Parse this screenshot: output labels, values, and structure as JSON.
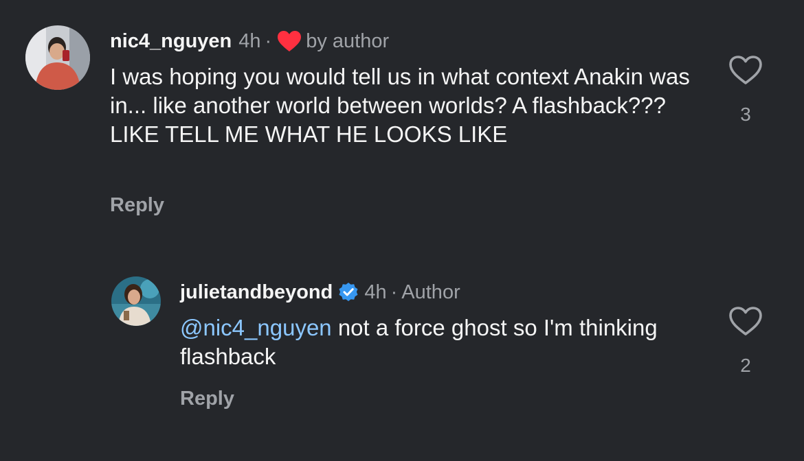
{
  "comments": [
    {
      "username": "nic4_nguyen",
      "time": "4h",
      "separator": "·",
      "liked_by_author_label": "by author",
      "text": "I was hoping you would tell us in what context Anakin was in... like another world between worlds? A flashback??? LIKE TELL ME WHAT HE LOOKS LIKE",
      "reply_label": "Reply",
      "like_count": "3",
      "heart_color": "#ff3040"
    },
    {
      "username": "julietandbeyond",
      "time": "4h",
      "separator": "·",
      "role": "Author",
      "mention": "@nic4_nguyen",
      "text": " not a force ghost so I'm thinking flashback",
      "reply_label": "Reply",
      "like_count": "2",
      "verified_color": "#3797f0"
    }
  ],
  "icons": {
    "like": "heart-outline-icon",
    "liked_by_author": "heart-filled-icon",
    "verified": "verified-badge-icon"
  }
}
